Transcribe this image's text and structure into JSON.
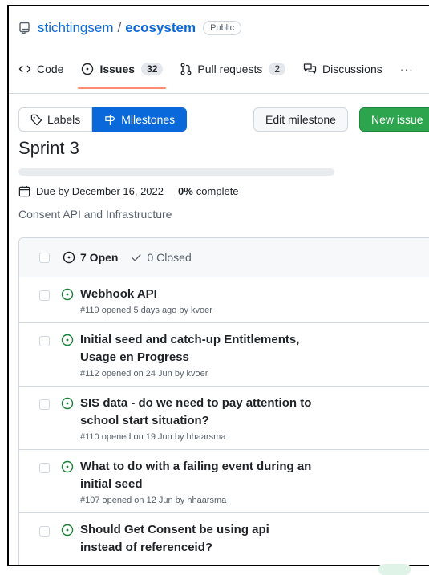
{
  "repo": {
    "owner": "stichtingsem",
    "name": "ecosystem",
    "visibility": "Public"
  },
  "tabs": [
    {
      "label": "Code",
      "icon": "code-icon"
    },
    {
      "label": "Issues",
      "icon": "issue-opened-icon",
      "count": "32",
      "active": true
    },
    {
      "label": "Pull requests",
      "icon": "git-pull-request-icon",
      "count": "2"
    },
    {
      "label": "Discussions",
      "icon": "comment-discussion-icon"
    }
  ],
  "tabs_more": "···",
  "buttons": {
    "labels": "Labels",
    "milestones": "Milestones",
    "edit_milestone": "Edit milestone",
    "new_issue": "New issue"
  },
  "milestone": {
    "title": "Sprint 3",
    "due": "Due by December 16, 2022",
    "percent": "0%",
    "percent_label": "complete",
    "progress": 0,
    "description": "Consent API and Infrastructure"
  },
  "filters": {
    "open": "7 Open",
    "closed": "0 Closed"
  },
  "issues": [
    {
      "title": "Webhook API",
      "meta": "#119 opened 5 days ago by kvoer"
    },
    {
      "title": "Initial seed and catch-up Entitlements, Usage en Progress",
      "meta": "#112 opened on 24 Jun by kvoer"
    },
    {
      "title": "SIS data - do we need to pay attention to school start situation?",
      "meta": "#110 opened on 19 Jun by hhaarsma"
    },
    {
      "title": "What to do with a failing event during an initial seed",
      "meta": "#107 opened on 12 Jun by hhaarsma"
    },
    {
      "title": "Should Get Consent be using api instead of referenceid?",
      "meta": ""
    }
  ],
  "colors": {
    "accent": "#0969da",
    "open_green": "#1a7f37",
    "new_issue_green": "#2da44e",
    "tab_underline": "#fd8c73"
  }
}
